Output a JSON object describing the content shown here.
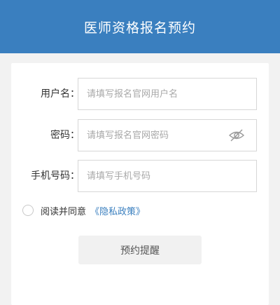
{
  "header": {
    "title": "医师资格报名预约"
  },
  "form": {
    "username": {
      "label": "用户名：",
      "placeholder": "请填写报名官网用户名",
      "value": ""
    },
    "password": {
      "label": "密码：",
      "placeholder": "请填写报名官网密码",
      "value": "",
      "toggle_icon": "eye-off-icon"
    },
    "phone": {
      "label": "手机号码：",
      "placeholder": "请填写手机号码",
      "value": ""
    },
    "agreement": {
      "text": "阅读并同意",
      "link": "《隐私政策》",
      "checked": false
    },
    "submit_label": "预约提醒"
  },
  "colors": {
    "header_bg": "#3a7fbf",
    "link": "#3a7fbf",
    "page_bg": "#f2f2f2",
    "button_bg": "#f1f1f1"
  }
}
